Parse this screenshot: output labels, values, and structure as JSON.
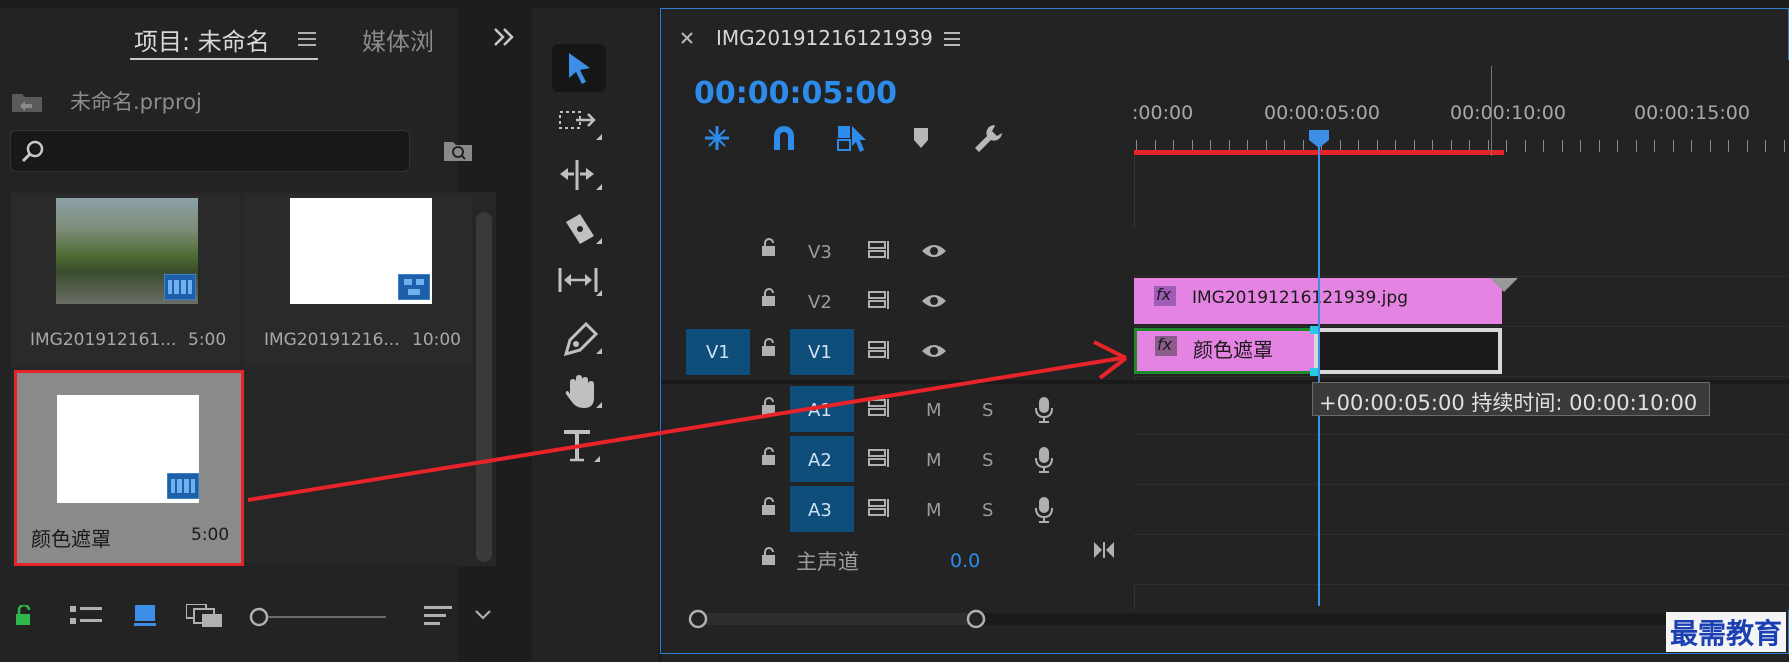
{
  "project_panel": {
    "tab_project": "项目: 未命名",
    "tab_media": "媒体浏",
    "project_file": "未命名.prproj",
    "search_placeholder": "",
    "items": [
      {
        "name": "IMG201912161...",
        "duration": "5:00"
      },
      {
        "name": "IMG20191216...",
        "duration": "10:00"
      },
      {
        "name": "颜色遮罩",
        "duration": "5:00"
      }
    ]
  },
  "timeline": {
    "sequence_name": "IMG20191216121939",
    "timecode": "00:00:05:00",
    "ruler": [
      ":00:00",
      "00:00:05:00",
      "00:00:10:00",
      "00:00:15:00"
    ],
    "video_tracks": [
      {
        "label": "V3"
      },
      {
        "label": "V2"
      },
      {
        "label": "V1",
        "source": "V1"
      }
    ],
    "audio_tracks": [
      {
        "label": "A1",
        "m": "M",
        "s": "S"
      },
      {
        "label": "A2",
        "m": "M",
        "s": "S"
      },
      {
        "label": "A3",
        "m": "M",
        "s": "S"
      }
    ],
    "master": {
      "label": "主声道",
      "value": "0.0"
    },
    "clips": {
      "v2": {
        "fx": "fx",
        "name": "IMG20191216121939.jpg"
      },
      "v1": {
        "fx": "fx",
        "name": "颜色遮罩"
      }
    },
    "tooltip": "+00:00:05:00 持续时间: 00:00:10:00"
  },
  "watermark": "最需教育",
  "colors": {
    "accent_blue": "#2d8ceb",
    "clip_pink": "#e583e3",
    "annotation_red": "#e8232a",
    "track_target": "#0f4d7a"
  }
}
